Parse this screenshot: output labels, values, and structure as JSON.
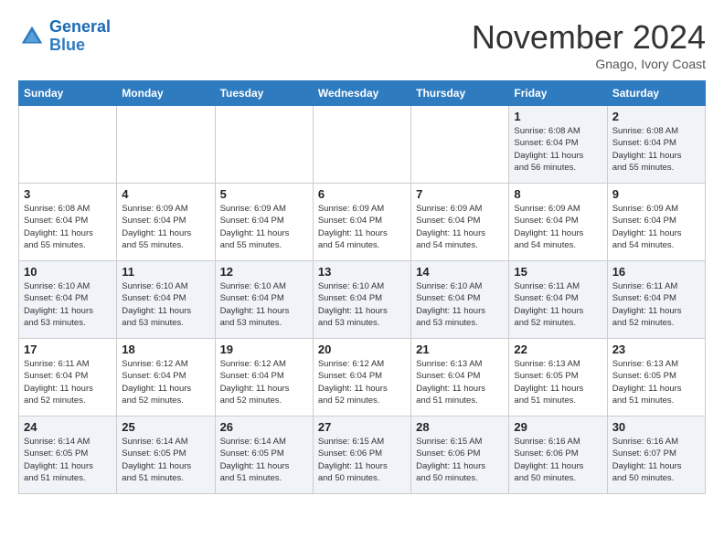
{
  "header": {
    "logo_line1": "General",
    "logo_line2": "Blue",
    "month": "November 2024",
    "location": "Gnago, Ivory Coast"
  },
  "weekdays": [
    "Sunday",
    "Monday",
    "Tuesday",
    "Wednesday",
    "Thursday",
    "Friday",
    "Saturday"
  ],
  "weeks": [
    [
      {
        "day": "",
        "info": ""
      },
      {
        "day": "",
        "info": ""
      },
      {
        "day": "",
        "info": ""
      },
      {
        "day": "",
        "info": ""
      },
      {
        "day": "",
        "info": ""
      },
      {
        "day": "1",
        "info": "Sunrise: 6:08 AM\nSunset: 6:04 PM\nDaylight: 11 hours\nand 56 minutes."
      },
      {
        "day": "2",
        "info": "Sunrise: 6:08 AM\nSunset: 6:04 PM\nDaylight: 11 hours\nand 55 minutes."
      }
    ],
    [
      {
        "day": "3",
        "info": "Sunrise: 6:08 AM\nSunset: 6:04 PM\nDaylight: 11 hours\nand 55 minutes."
      },
      {
        "day": "4",
        "info": "Sunrise: 6:09 AM\nSunset: 6:04 PM\nDaylight: 11 hours\nand 55 minutes."
      },
      {
        "day": "5",
        "info": "Sunrise: 6:09 AM\nSunset: 6:04 PM\nDaylight: 11 hours\nand 55 minutes."
      },
      {
        "day": "6",
        "info": "Sunrise: 6:09 AM\nSunset: 6:04 PM\nDaylight: 11 hours\nand 54 minutes."
      },
      {
        "day": "7",
        "info": "Sunrise: 6:09 AM\nSunset: 6:04 PM\nDaylight: 11 hours\nand 54 minutes."
      },
      {
        "day": "8",
        "info": "Sunrise: 6:09 AM\nSunset: 6:04 PM\nDaylight: 11 hours\nand 54 minutes."
      },
      {
        "day": "9",
        "info": "Sunrise: 6:09 AM\nSunset: 6:04 PM\nDaylight: 11 hours\nand 54 minutes."
      }
    ],
    [
      {
        "day": "10",
        "info": "Sunrise: 6:10 AM\nSunset: 6:04 PM\nDaylight: 11 hours\nand 53 minutes."
      },
      {
        "day": "11",
        "info": "Sunrise: 6:10 AM\nSunset: 6:04 PM\nDaylight: 11 hours\nand 53 minutes."
      },
      {
        "day": "12",
        "info": "Sunrise: 6:10 AM\nSunset: 6:04 PM\nDaylight: 11 hours\nand 53 minutes."
      },
      {
        "day": "13",
        "info": "Sunrise: 6:10 AM\nSunset: 6:04 PM\nDaylight: 11 hours\nand 53 minutes."
      },
      {
        "day": "14",
        "info": "Sunrise: 6:10 AM\nSunset: 6:04 PM\nDaylight: 11 hours\nand 53 minutes."
      },
      {
        "day": "15",
        "info": "Sunrise: 6:11 AM\nSunset: 6:04 PM\nDaylight: 11 hours\nand 52 minutes."
      },
      {
        "day": "16",
        "info": "Sunrise: 6:11 AM\nSunset: 6:04 PM\nDaylight: 11 hours\nand 52 minutes."
      }
    ],
    [
      {
        "day": "17",
        "info": "Sunrise: 6:11 AM\nSunset: 6:04 PM\nDaylight: 11 hours\nand 52 minutes."
      },
      {
        "day": "18",
        "info": "Sunrise: 6:12 AM\nSunset: 6:04 PM\nDaylight: 11 hours\nand 52 minutes."
      },
      {
        "day": "19",
        "info": "Sunrise: 6:12 AM\nSunset: 6:04 PM\nDaylight: 11 hours\nand 52 minutes."
      },
      {
        "day": "20",
        "info": "Sunrise: 6:12 AM\nSunset: 6:04 PM\nDaylight: 11 hours\nand 52 minutes."
      },
      {
        "day": "21",
        "info": "Sunrise: 6:13 AM\nSunset: 6:04 PM\nDaylight: 11 hours\nand 51 minutes."
      },
      {
        "day": "22",
        "info": "Sunrise: 6:13 AM\nSunset: 6:05 PM\nDaylight: 11 hours\nand 51 minutes."
      },
      {
        "day": "23",
        "info": "Sunrise: 6:13 AM\nSunset: 6:05 PM\nDaylight: 11 hours\nand 51 minutes."
      }
    ],
    [
      {
        "day": "24",
        "info": "Sunrise: 6:14 AM\nSunset: 6:05 PM\nDaylight: 11 hours\nand 51 minutes."
      },
      {
        "day": "25",
        "info": "Sunrise: 6:14 AM\nSunset: 6:05 PM\nDaylight: 11 hours\nand 51 minutes."
      },
      {
        "day": "26",
        "info": "Sunrise: 6:14 AM\nSunset: 6:05 PM\nDaylight: 11 hours\nand 51 minutes."
      },
      {
        "day": "27",
        "info": "Sunrise: 6:15 AM\nSunset: 6:06 PM\nDaylight: 11 hours\nand 50 minutes."
      },
      {
        "day": "28",
        "info": "Sunrise: 6:15 AM\nSunset: 6:06 PM\nDaylight: 11 hours\nand 50 minutes."
      },
      {
        "day": "29",
        "info": "Sunrise: 6:16 AM\nSunset: 6:06 PM\nDaylight: 11 hours\nand 50 minutes."
      },
      {
        "day": "30",
        "info": "Sunrise: 6:16 AM\nSunset: 6:07 PM\nDaylight: 11 hours\nand 50 minutes."
      }
    ]
  ]
}
